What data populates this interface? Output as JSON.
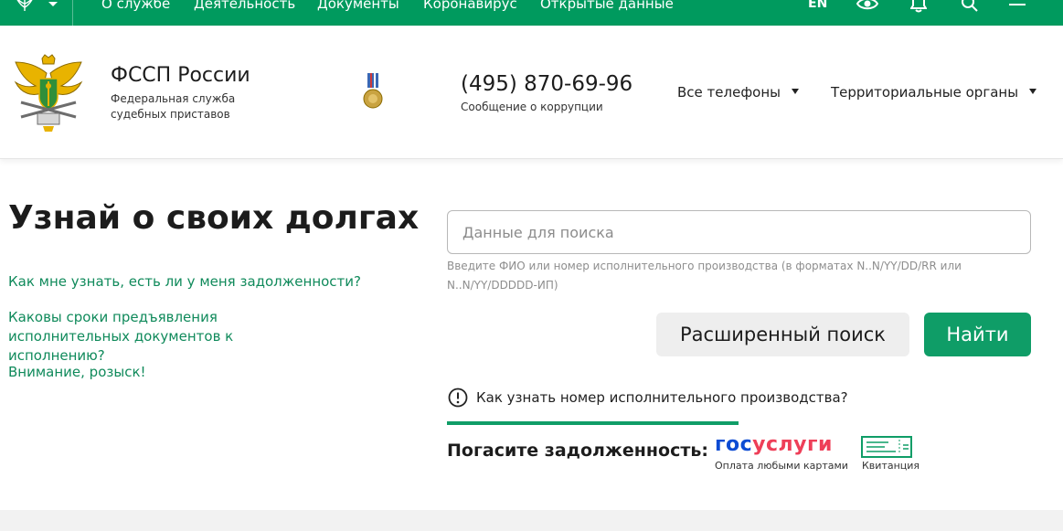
{
  "topnav": {
    "menu": [
      {
        "label": "О службе"
      },
      {
        "label": "Деятельность"
      },
      {
        "label": "Документы"
      },
      {
        "label": "Коронавирус"
      },
      {
        "label": "Открытые данные"
      }
    ],
    "lang_label": "EN",
    "icons": [
      "eye-icon",
      "bell-icon",
      "search-icon",
      "menu-icon"
    ]
  },
  "header": {
    "org_name": "ФССП России",
    "org_subtitle": "Федеральная служба судебных приставов",
    "phone": "(495) 870-69-96",
    "phone_caption": "Сообщение о коррупции",
    "dropdowns": [
      {
        "label": "Все телефоны"
      },
      {
        "label": "Территориальные органы"
      }
    ]
  },
  "main": {
    "title": "Узнай о своих долгах",
    "links": [
      {
        "label": "Как мне узнать, есть ли у меня задолженности?"
      },
      {
        "label": "Каковы сроки предъявления исполнительных документов к исполнению?"
      },
      {
        "label": "Внимание, розыск!"
      }
    ],
    "search": {
      "placeholder": "Данные для поиска",
      "value": "",
      "hint": "Введите ФИО или номер исполнительного производства (в форматах N..N/YY/DD/RR или N..N/YY/DDDDD-ИП)"
    },
    "advanced_search_label": "Расширенный поиск",
    "find_label": "Найти",
    "info_link": "Как узнать номер исполнительного производства?",
    "pay": {
      "label": "Погасите задолженность:",
      "gosuslugi": {
        "part1": "гос",
        "part2": "услуги",
        "caption": "Оплата любыми картами"
      },
      "receipt": {
        "caption": "Квитанция"
      }
    }
  },
  "colors": {
    "brand_green": "#009a5e",
    "button_green": "#0f9d67",
    "link_green": "#108a5b",
    "gos_blue": "#0d4cd3",
    "gos_red": "#ee3f58"
  }
}
